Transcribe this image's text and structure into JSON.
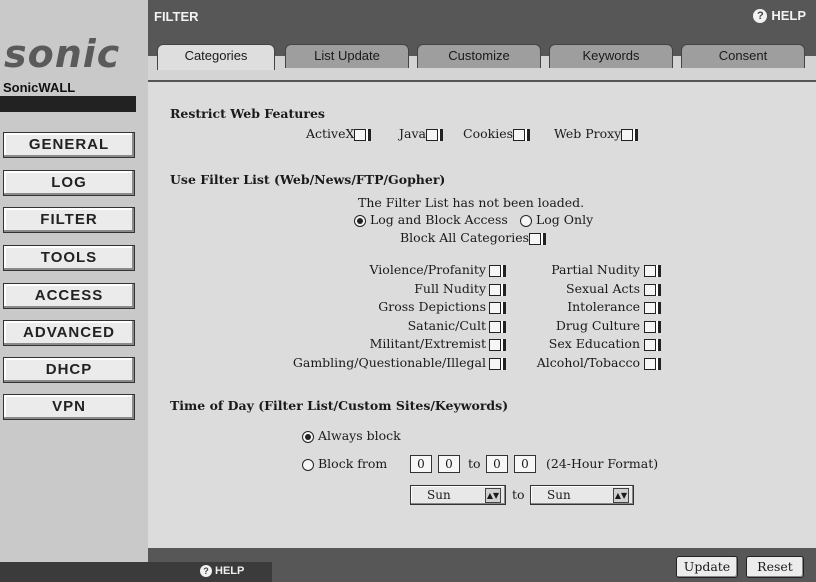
{
  "brand": {
    "logo": "sonic",
    "name": "SonicWALL"
  },
  "nav": [
    "GENERAL",
    "LOG",
    "FILTER",
    "TOOLS",
    "ACCESS",
    "ADVANCED",
    "DHCP",
    "VPN"
  ],
  "header": {
    "title": "FILTER",
    "help": "HELP"
  },
  "tabs": [
    "Categories",
    "List Update",
    "Customize",
    "Keywords",
    "Consent"
  ],
  "restrict": {
    "heading": "Restrict Web Features",
    "items": [
      "ActiveX",
      "Java",
      "Cookies",
      "Web Proxy"
    ]
  },
  "filter_list": {
    "heading": "Use Filter List (Web/News/FTP/Gopher)",
    "status": "The Filter List has not been loaded.",
    "log_block": "Log and Block Access",
    "log_only": "Log Only",
    "block_all": "Block All Categories",
    "left_categories": [
      "Violence/Profanity",
      "Full Nudity",
      "Gross Depictions",
      "Satanic/Cult",
      "Militant/Extremist",
      "Gambling/Questionable/Illegal"
    ],
    "right_categories": [
      "Partial Nudity",
      "Sexual Acts",
      "Intolerance",
      "Drug Culture",
      "Sex Education",
      "Alcohol/Tobacco"
    ]
  },
  "time_of_day": {
    "heading": "Time of Day (Filter List/Custom Sites/Keywords)",
    "always": "Always block",
    "block_from": "Block from",
    "from_h": "0",
    "from_m": "0",
    "to_word": "to",
    "to_h": "0",
    "to_m": "0",
    "format": "(24-Hour Format)",
    "day_from": "Sun",
    "day_to": "Sun"
  },
  "footer": {
    "update": "Update",
    "reset": "Reset",
    "help": "HELP"
  }
}
